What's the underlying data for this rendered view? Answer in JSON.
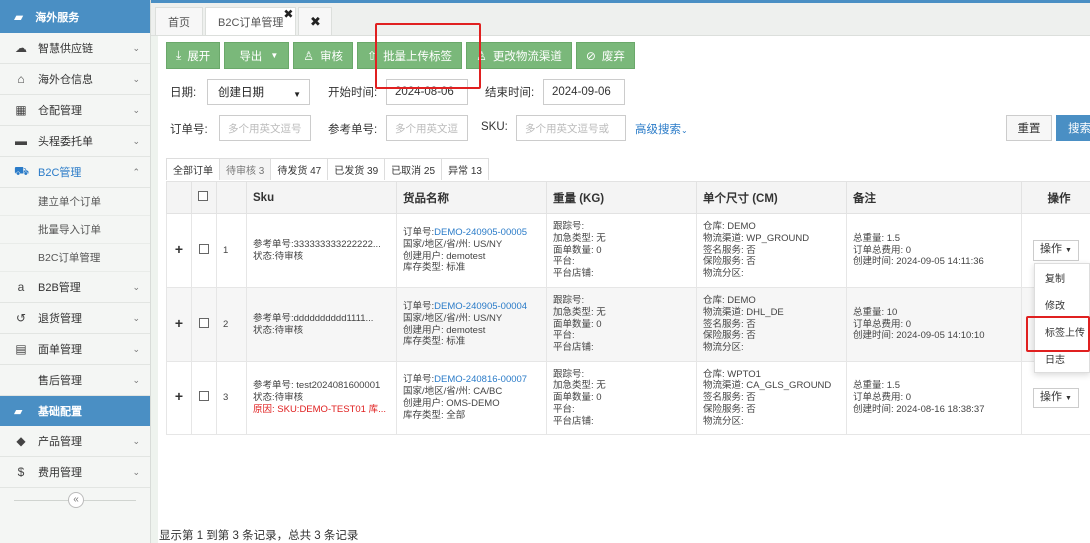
{
  "sidebar": {
    "top": "海外服务",
    "items": [
      {
        "icon": "cloud-icon",
        "glyph": "☁",
        "label": "智慧供应链"
      },
      {
        "icon": "home-icon",
        "glyph": "⌂",
        "label": "海外仓信息"
      },
      {
        "icon": "grid-icon",
        "glyph": "▦",
        "label": "仓配管理"
      },
      {
        "icon": "briefcase-icon",
        "glyph": "▬",
        "label": "头程委托单"
      },
      {
        "icon": "cart-icon",
        "glyph": "⛟",
        "label": "B2C管理"
      }
    ],
    "sub_items": [
      "建立单个订单",
      "批量导入订单",
      "B2C订单管理"
    ],
    "items2": [
      {
        "icon": "amazon-icon",
        "glyph": "a",
        "label": "B2B管理"
      },
      {
        "icon": "return-icon",
        "glyph": "↺",
        "label": "退货管理"
      },
      {
        "icon": "doc-icon",
        "glyph": "▤",
        "label": "面单管理"
      },
      {
        "icon": "none",
        "glyph": "",
        "label": "售后管理"
      }
    ],
    "section": "基础配置",
    "items3": [
      {
        "icon": "tag-icon",
        "glyph": "◆",
        "label": "产品管理"
      },
      {
        "icon": "dollar-icon",
        "glyph": "$",
        "label": "费用管理"
      }
    ],
    "collapse": "«"
  },
  "tabs": {
    "home": "首页",
    "b2c": "B2C订单管理",
    "close_mark": "✖",
    "close_all": "✖"
  },
  "toolbar": {
    "expand": "展开",
    "export": "导出",
    "review": "审核",
    "batch_upload": "批量上传标签",
    "change_channel": "更改物流渠道",
    "discard": "废弃"
  },
  "filters": {
    "date_label": "日期:",
    "date_select": "创建日期",
    "start_label": "开始时间:",
    "start_value": "2024-08-06",
    "end_label": "结束时间:",
    "end_value": "2024-09-06",
    "order_label": "订单号:",
    "order_ph": "多个用英文逗号",
    "ref_label": "参考单号:",
    "ref_ph": "多个用英文逗",
    "sku_label": "SKU:",
    "sku_ph": "多个用英文逗号或",
    "advanced": "高级搜索",
    "reset": "重置",
    "search": "搜索"
  },
  "status_tabs": [
    "全部订单",
    "待审核 3",
    "待发货 47",
    "已发货 39",
    "已取消 25",
    "异常 13"
  ],
  "table": {
    "headers": [
      "Sku",
      "货品名称",
      "重量 (KG)",
      "单个尺寸 (CM)",
      "备注",
      "操作"
    ],
    "rows": [
      {
        "no": "1",
        "sku": [
          "参考单号:333333333222222...",
          "状态:待审核"
        ],
        "reason": "",
        "order_no": "DEMO-240905-00005",
        "goods": [
          "国家/地区/省/州: US/NY",
          "创建用户: demotest",
          "库存类型: 标准"
        ],
        "weight": [
          "跟踪号:",
          "加急类型: 无",
          "面单数量: 0",
          "平台:",
          "平台店铺:"
        ],
        "size": [
          "仓库: DEMO",
          "物流渠道: WP_GROUND",
          "签名服务: 否",
          "保险服务: 否",
          "物流分区:"
        ],
        "remark": [
          "总重量: 1.5",
          "订单总费用: 0",
          "创建时间: 2024-09-05 14:11:36"
        ],
        "op": "操作"
      },
      {
        "no": "2",
        "sku": [
          "参考单号:dddddddddd1111...",
          "状态:待审核"
        ],
        "reason": "",
        "order_no": "DEMO-240905-00004",
        "goods": [
          "国家/地区/省/州: US/NY",
          "创建用户: demotest",
          "库存类型: 标准"
        ],
        "weight": [
          "跟踪号:",
          "加急类型: 无",
          "面单数量: 0",
          "平台:",
          "平台店铺:"
        ],
        "size": [
          "仓库: DEMO",
          "物流渠道: DHL_DE",
          "签名服务: 否",
          "保险服务: 否",
          "物流分区:"
        ],
        "remark": [
          "总重量: 10",
          "订单总费用: 0",
          "创建时间: 2024-09-05 14:10:10"
        ],
        "op": ""
      },
      {
        "no": "3",
        "sku": [
          "参考单号: test2024081600001",
          "状态:待审核"
        ],
        "reason": "原因: SKU:DEMO-TEST01 库...",
        "order_no": "DEMO-240816-00007",
        "goods": [
          "国家/地区/省/州: CA/BC",
          "创建用户: OMS-DEMO",
          "库存类型: 全部"
        ],
        "weight": [
          "跟踪号:",
          "加急类型: 无",
          "面单数量: 0",
          "平台:",
          "平台店铺:"
        ],
        "size": [
          "仓库: WPTO1",
          "物流渠道: CA_GLS_GROUND",
          "签名服务: 否",
          "保险服务: 否",
          "物流分区:"
        ],
        "remark": [
          "总重量: 1.5",
          "订单总费用: 0",
          "创建时间: 2024-08-16 18:38:37"
        ],
        "op": "操作"
      }
    ],
    "order_prefix": "订单号:"
  },
  "dropdown": [
    "复制",
    "修改",
    "标签上传",
    "日志"
  ],
  "footer": "显示第 1 到第 3 条记录，总共 3 条记录"
}
